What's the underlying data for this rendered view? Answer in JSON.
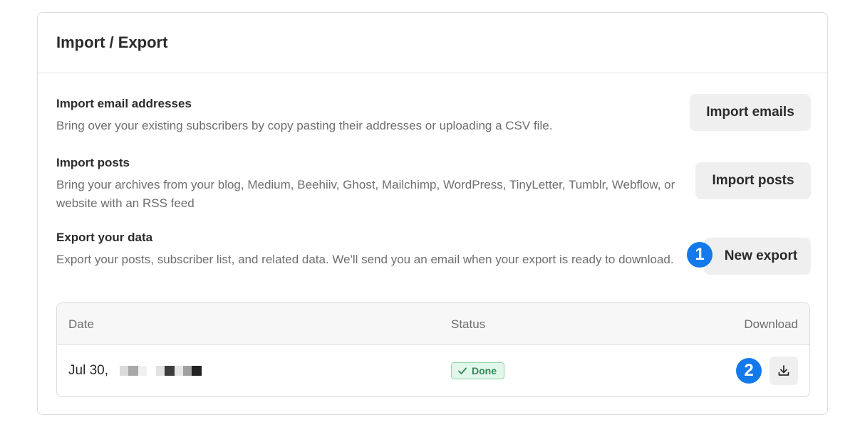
{
  "card": {
    "title": "Import / Export"
  },
  "import_emails": {
    "title": "Import email addresses",
    "description": "Bring over your existing subscribers by copy pasting their addresses or uploading a CSV file.",
    "button_label": "Import emails"
  },
  "import_posts": {
    "title": "Import posts",
    "description": "Bring your archives from your blog, Medium, Beehiiv, Ghost, Mailchimp, WordPress, TinyLetter, Tumblr, Webflow, or website with an RSS feed",
    "button_label": "Import posts"
  },
  "export_data": {
    "title": "Export your data",
    "description": "Export your posts, subscriber list, and related data. We'll send you an email when your export is ready to download.",
    "button_label": "New export",
    "step_badge": "1"
  },
  "exports_table": {
    "columns": [
      "Date",
      "Status",
      "Download"
    ],
    "rows": [
      {
        "date": "Jul 30,",
        "status": "Done",
        "step_badge": "2",
        "download_icon": "download-icon"
      }
    ]
  },
  "colors": {
    "accent_badge": "#1479ea",
    "status_done_bg": "#e1f7ea",
    "status_done_text": "#2e8a58",
    "button_bg": "#efefef"
  }
}
